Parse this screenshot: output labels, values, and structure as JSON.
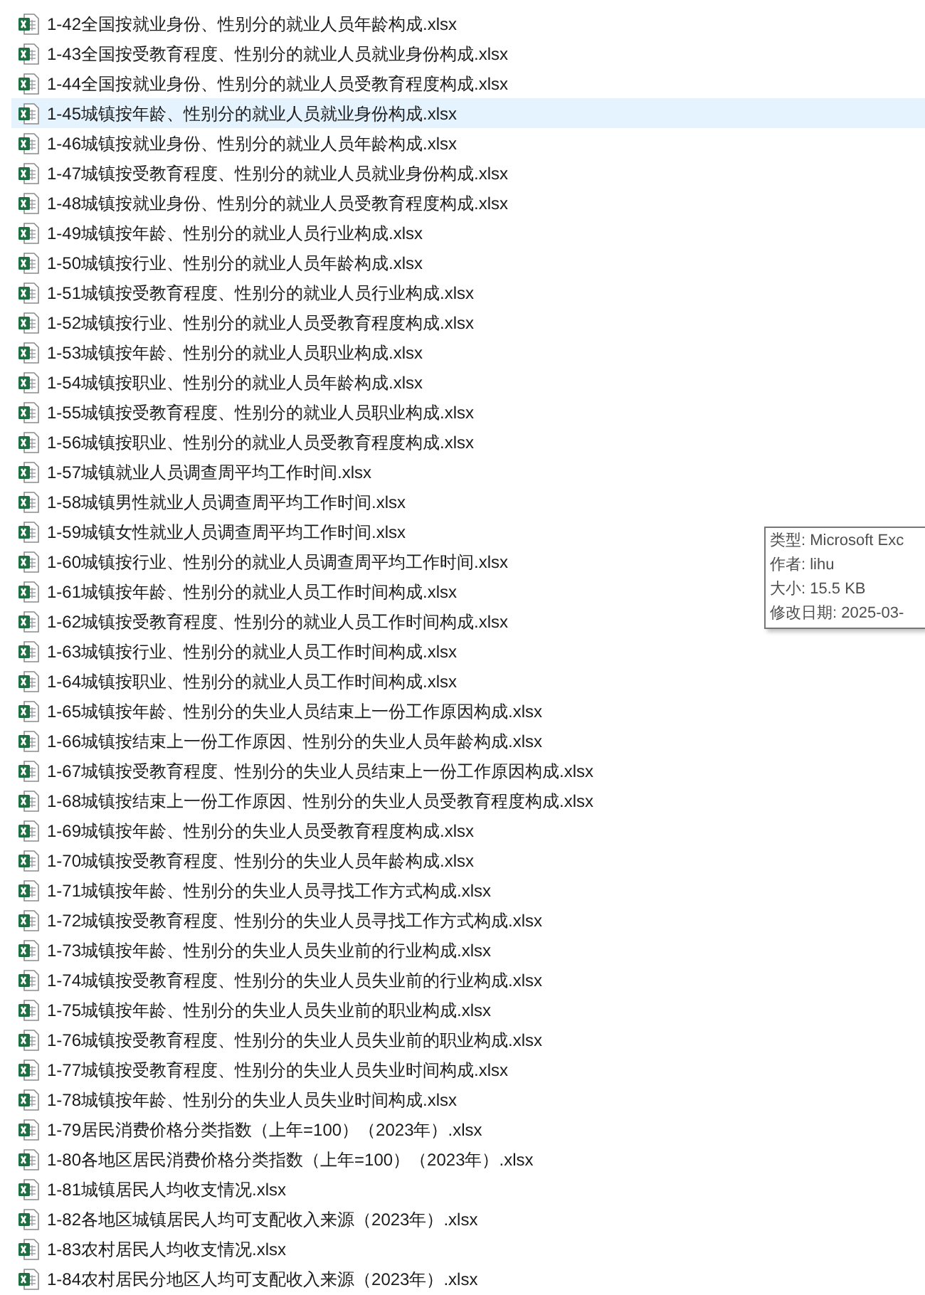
{
  "files": [
    {
      "name": "1-42全国按就业身份、性别分的就业人员年龄构成.xlsx",
      "selected": false
    },
    {
      "name": "1-43全国按受教育程度、性别分的就业人员就业身份构成.xlsx",
      "selected": false
    },
    {
      "name": "1-44全国按就业身份、性别分的就业人员受教育程度构成.xlsx",
      "selected": false
    },
    {
      "name": "1-45城镇按年龄、性别分的就业人员就业身份构成.xlsx",
      "selected": true
    },
    {
      "name": "1-46城镇按就业身份、性别分的就业人员年龄构成.xlsx",
      "selected": false
    },
    {
      "name": "1-47城镇按受教育程度、性别分的就业人员就业身份构成.xlsx",
      "selected": false
    },
    {
      "name": "1-48城镇按就业身份、性别分的就业人员受教育程度构成.xlsx",
      "selected": false
    },
    {
      "name": "1-49城镇按年龄、性别分的就业人员行业构成.xlsx",
      "selected": false
    },
    {
      "name": "1-50城镇按行业、性别分的就业人员年龄构成.xlsx",
      "selected": false
    },
    {
      "name": "1-51城镇按受教育程度、性别分的就业人员行业构成.xlsx",
      "selected": false
    },
    {
      "name": "1-52城镇按行业、性别分的就业人员受教育程度构成.xlsx",
      "selected": false
    },
    {
      "name": "1-53城镇按年龄、性别分的就业人员职业构成.xlsx",
      "selected": false
    },
    {
      "name": "1-54城镇按职业、性别分的就业人员年龄构成.xlsx",
      "selected": false
    },
    {
      "name": "1-55城镇按受教育程度、性别分的就业人员职业构成.xlsx",
      "selected": false
    },
    {
      "name": "1-56城镇按职业、性别分的就业人员受教育程度构成.xlsx",
      "selected": false
    },
    {
      "name": "1-57城镇就业人员调查周平均工作时间.xlsx",
      "selected": false
    },
    {
      "name": "1-58城镇男性就业人员调查周平均工作时间.xlsx",
      "selected": false
    },
    {
      "name": "1-59城镇女性就业人员调查周平均工作时间.xlsx",
      "selected": false
    },
    {
      "name": "1-60城镇按行业、性别分的就业人员调查周平均工作时间.xlsx",
      "selected": false
    },
    {
      "name": "1-61城镇按年龄、性别分的就业人员工作时间构成.xlsx",
      "selected": false
    },
    {
      "name": "1-62城镇按受教育程度、性别分的就业人员工作时间构成.xlsx",
      "selected": false
    },
    {
      "name": "1-63城镇按行业、性别分的就业人员工作时间构成.xlsx",
      "selected": false
    },
    {
      "name": "1-64城镇按职业、性别分的就业人员工作时间构成.xlsx",
      "selected": false
    },
    {
      "name": "1-65城镇按年龄、性别分的失业人员结束上一份工作原因构成.xlsx",
      "selected": false
    },
    {
      "name": "1-66城镇按结束上一份工作原因、性别分的失业人员年龄构成.xlsx",
      "selected": false
    },
    {
      "name": "1-67城镇按受教育程度、性别分的失业人员结束上一份工作原因构成.xlsx",
      "selected": false
    },
    {
      "name": "1-68城镇按结束上一份工作原因、性别分的失业人员受教育程度构成.xlsx",
      "selected": false
    },
    {
      "name": "1-69城镇按年龄、性别分的失业人员受教育程度构成.xlsx",
      "selected": false
    },
    {
      "name": "1-70城镇按受教育程度、性别分的失业人员年龄构成.xlsx",
      "selected": false
    },
    {
      "name": "1-71城镇按年龄、性别分的失业人员寻找工作方式构成.xlsx",
      "selected": false
    },
    {
      "name": "1-72城镇按受教育程度、性别分的失业人员寻找工作方式构成.xlsx",
      "selected": false
    },
    {
      "name": "1-73城镇按年龄、性别分的失业人员失业前的行业构成.xlsx",
      "selected": false
    },
    {
      "name": "1-74城镇按受教育程度、性别分的失业人员失业前的行业构成.xlsx",
      "selected": false
    },
    {
      "name": "1-75城镇按年龄、性别分的失业人员失业前的职业构成.xlsx",
      "selected": false
    },
    {
      "name": "1-76城镇按受教育程度、性别分的失业人员失业前的职业构成.xlsx",
      "selected": false
    },
    {
      "name": "1-77城镇按受教育程度、性别分的失业人员失业时间构成.xlsx",
      "selected": false
    },
    {
      "name": "1-78城镇按年龄、性别分的失业人员失业时间构成.xlsx",
      "selected": false
    },
    {
      "name": "1-79居民消费价格分类指数（上年=100）（2023年）.xlsx",
      "selected": false
    },
    {
      "name": "1-80各地区居民消费价格分类指数（上年=100）（2023年）.xlsx",
      "selected": false
    },
    {
      "name": "1-81城镇居民人均收支情况.xlsx",
      "selected": false
    },
    {
      "name": "1-82各地区城镇居民人均可支配收入来源（2023年）.xlsx",
      "selected": false
    },
    {
      "name": "1-83农村居民人均收支情况.xlsx",
      "selected": false
    },
    {
      "name": "1-84农村居民分地区人均可支配收入来源（2023年）.xlsx",
      "selected": false
    }
  ],
  "tooltip": {
    "lines": [
      "类型: Microsoft Exc",
      "作者: lihu",
      "大小: 15.5 KB",
      "修改日期: 2025-03-"
    ]
  }
}
